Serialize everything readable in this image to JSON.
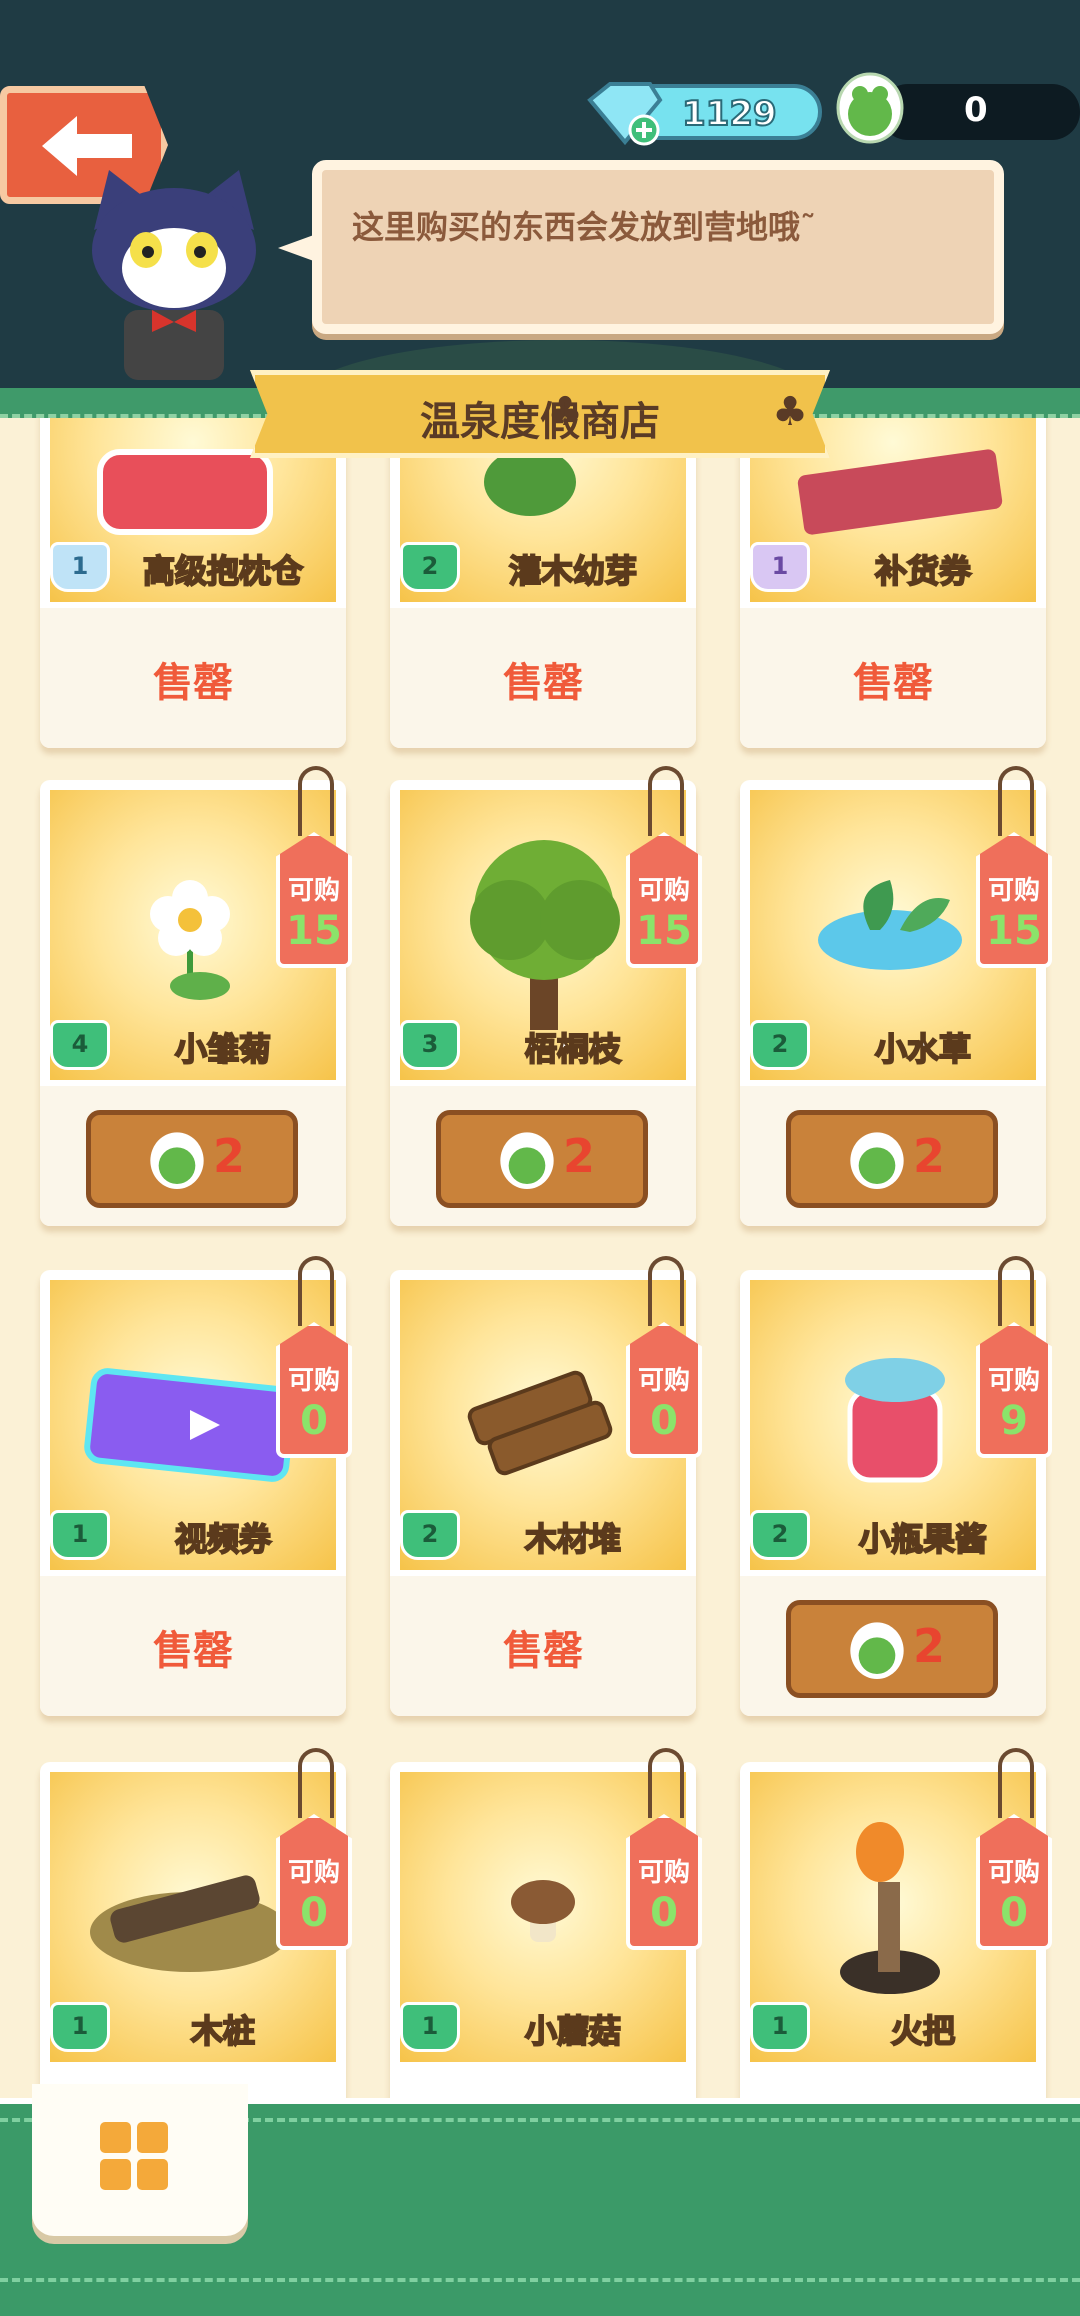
{
  "header": {
    "gems": "1129",
    "frog_coins": "0",
    "speech": "这里购买的东西会发放到营地哦˜",
    "shop_title": "温泉度假商店"
  },
  "labels": {
    "sold_out": "售罄",
    "can_buy": "可购"
  },
  "colors": {
    "accent": "#f05a3a",
    "green": "#3fbf7a",
    "header": "#1f3b44"
  },
  "items": [
    {
      "name": "高级抱枕仓",
      "rank": "1",
      "status": "售罄"
    },
    {
      "name": "灌木幼芽",
      "rank": "2",
      "status": "售罄"
    },
    {
      "name": "补货券",
      "rank": "1",
      "status": "售罄"
    },
    {
      "name": "小雏菊",
      "rank": "4",
      "stock": "15",
      "price": "2"
    },
    {
      "name": "梧桐枝",
      "rank": "3",
      "stock": "15",
      "price": "2"
    },
    {
      "name": "小水草",
      "rank": "2",
      "stock": "15",
      "price": "2"
    },
    {
      "name": "视频券",
      "rank": "1",
      "stock": "0",
      "status": "售罄"
    },
    {
      "name": "木材堆",
      "rank": "2",
      "stock": "0",
      "status": "售罄"
    },
    {
      "name": "小瓶果酱",
      "rank": "2",
      "stock": "9",
      "price": "2"
    },
    {
      "name": "木桩",
      "rank": "1",
      "stock": "0"
    },
    {
      "name": "小蘑菇",
      "rank": "1",
      "stock": "0"
    },
    {
      "name": "火把",
      "rank": "1",
      "stock": "0"
    }
  ]
}
